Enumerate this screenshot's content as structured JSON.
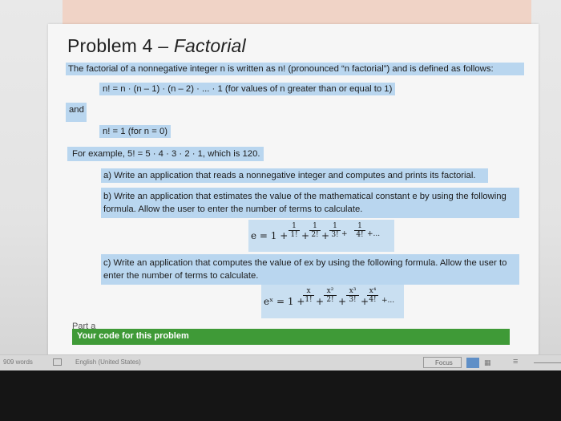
{
  "document": {
    "title_plain": "Problem 4 – ",
    "title_italic": "Factorial",
    "paragraph1": "The factorial of a nonnegative integer n is written as n! (pronounced “n factorial”) and is defined as follows:",
    "formula1": "n! = n · (n – 1) · (n – 2) · ... · 1 (for values of n greater than or equal to 1)",
    "and": "and",
    "formula2": "n! = 1 (for n = 0)",
    "example": "For example, 5! = 5 · 4 · 3 · 2 · 1, which is 120.",
    "item_a": "a) Write an application that reads a nonnegative integer and computes and prints its factorial.",
    "item_b": "b) Write an application that estimates the value of the mathematical constant e by using the following formula. Allow the user to enter the number of terms to calculate.",
    "item_c": "c) Write an application that computes the value of ex by using the following formula. Allow the user to enter the number of terms to calculate.",
    "formula_e": {
      "lhs": "e = 1 +",
      "plus": "+",
      "tail": "+...",
      "terms": [
        {
          "num": "1",
          "den": "1!"
        },
        {
          "num": "1",
          "den": "2!"
        },
        {
          "num": "1",
          "den": "3!"
        },
        {
          "num": "1",
          "den": "4!"
        }
      ]
    },
    "formula_ex": {
      "lhs": "eˣ = 1 +",
      "plus": "+",
      "tail": "+...",
      "terms": [
        {
          "num": "x",
          "den": "1!"
        },
        {
          "num": "x²",
          "den": "2!"
        },
        {
          "num": "x³",
          "den": "3!"
        },
        {
          "num": "x⁴",
          "den": "4!"
        }
      ]
    },
    "part_label": "Part a",
    "code_bar_label": "Your code for this problem"
  },
  "statusbar": {
    "words": "909 words",
    "language": "English (United States)",
    "focus": "Focus"
  },
  "colors": {
    "highlight": "#b9d6ef",
    "code_bar": "#3f9a37",
    "banner": "#f0d3c6"
  }
}
